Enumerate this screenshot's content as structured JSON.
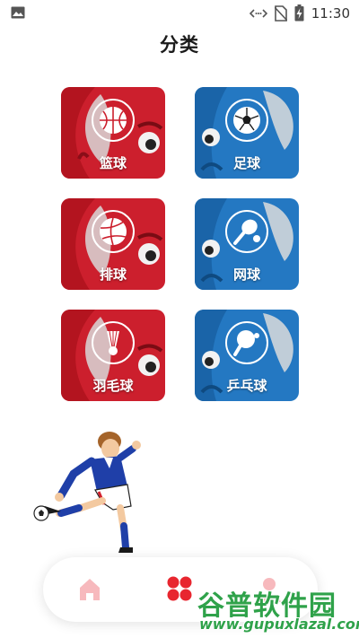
{
  "status_bar": {
    "time": "11:30",
    "icons": [
      "gallery-icon",
      "data-transfer-icon",
      "no-sim-icon",
      "battery-charging-icon"
    ]
  },
  "page": {
    "title": "分类"
  },
  "categories": [
    {
      "label": "篮球",
      "icon": "basketball-icon",
      "color": "#cc1f2d"
    },
    {
      "label": "足球",
      "icon": "soccer-ball-icon",
      "color": "#2478c2"
    },
    {
      "label": "排球",
      "icon": "volleyball-icon",
      "color": "#cc1f2d"
    },
    {
      "label": "网球",
      "icon": "tennis-racket-icon",
      "color": "#2478c2"
    },
    {
      "label": "羽毛球",
      "icon": "shuttlecock-icon",
      "color": "#cc1f2d"
    },
    {
      "label": "乒乓球",
      "icon": "ping-pong-paddle-icon",
      "color": "#2478c2"
    }
  ],
  "bottom_nav": {
    "items": [
      {
        "icon": "home-icon",
        "active": false
      },
      {
        "icon": "category-grid-icon",
        "active": true
      },
      {
        "icon": "profile-icon",
        "active": false
      }
    ],
    "accent": "#e8262f"
  },
  "watermark": {
    "chinese": "谷普软件园",
    "url": "www.gupuxlazal.com",
    "color": "#2fa24a"
  }
}
